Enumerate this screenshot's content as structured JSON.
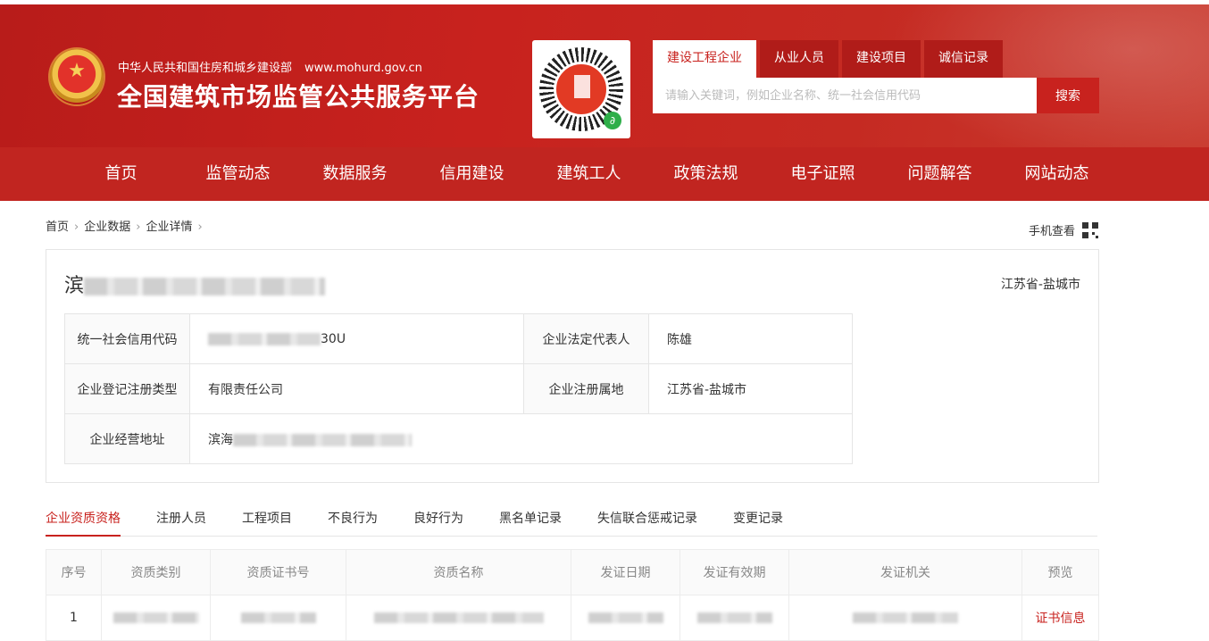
{
  "header": {
    "ministry": "中华人民共和国住房和城乡建设部",
    "url": "www.mohurd.gov.cn",
    "site_title": "全国建筑市场监管公共服务平台",
    "search_tabs": [
      "建设工程企业",
      "从业人员",
      "建设项目",
      "诚信记录"
    ],
    "search_placeholder": "请输入关键词，例如企业名称、统一社会信用代码",
    "search_button": "搜索"
  },
  "nav": [
    "首页",
    "监管动态",
    "数据服务",
    "信用建设",
    "建筑工人",
    "政策法规",
    "电子证照",
    "问题解答",
    "网站动态"
  ],
  "breadcrumb": [
    "首页",
    "企业数据",
    "企业详情"
  ],
  "mobile_view": "手机查看",
  "company": {
    "name_visible": "滨",
    "region": "江苏省-盐城市",
    "fields": {
      "credit_code_label": "统一社会信用代码",
      "credit_code_suffix": "30U",
      "legal_rep_label": "企业法定代表人",
      "legal_rep": "陈雄",
      "reg_type_label": "企业登记注册类型",
      "reg_type": "有限责任公司",
      "reg_place_label": "企业注册属地",
      "reg_place": "江苏省-盐城市",
      "address_label": "企业经营地址",
      "address_visible": "滨海"
    }
  },
  "tabs": [
    "企业资质资格",
    "注册人员",
    "工程项目",
    "不良行为",
    "良好行为",
    "黑名单记录",
    "失信联合惩戒记录",
    "变更记录"
  ],
  "qualification_table": {
    "headers": [
      "序号",
      "资质类别",
      "资质证书号",
      "资质名称",
      "发证日期",
      "发证有效期",
      "发证机关",
      "预览"
    ],
    "rows": [
      {
        "index": "1",
        "preview": "证书信息"
      }
    ]
  }
}
